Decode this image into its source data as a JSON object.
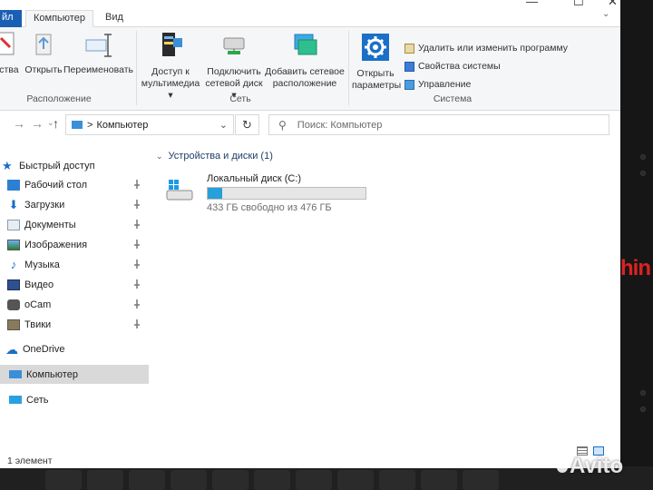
{
  "titlebar": {
    "controls": [
      "—",
      "☐",
      "✕"
    ]
  },
  "ribbon_tabs": {
    "file": "йл",
    "computer": "Компьютер",
    "view": "Вид"
  },
  "ribbon": {
    "location_group": {
      "label": "Расположение",
      "properties": "йства",
      "open": "Открыть",
      "rename": "Переименовать"
    },
    "network_group": {
      "label": "Сеть",
      "media_access_l1": "Доступ к",
      "media_access_l2": "мультимедиа ▾",
      "map_drive_l1": "Подключить",
      "map_drive_l2": "сетевой диск ▾",
      "add_location_l1": "Добавить сетевое",
      "add_location_l2": "расположение"
    },
    "system_group": {
      "label": "Система",
      "open_settings_l1": "Открыть",
      "open_settings_l2": "параметры",
      "uninstall": "Удалить или изменить программу",
      "system_properties": "Свойства системы",
      "manage": "Управление"
    }
  },
  "address": {
    "path": "Компьютер",
    "search_placeholder": "Поиск: Компьютер"
  },
  "nav": {
    "quick_access": "Быстрый доступ",
    "items": [
      {
        "label": "Рабочий стол",
        "icon": "desktop-icon"
      },
      {
        "label": "Загрузки",
        "icon": "downloads-icon"
      },
      {
        "label": "Документы",
        "icon": "documents-icon"
      },
      {
        "label": "Изображения",
        "icon": "pictures-icon"
      },
      {
        "label": "Музыка",
        "icon": "music-icon"
      },
      {
        "label": "Видео",
        "icon": "video-icon"
      },
      {
        "label": "oCam",
        "icon": "folder-icon"
      },
      {
        "label": "Твики",
        "icon": "folder-icon"
      }
    ],
    "onedrive": "OneDrive",
    "computer": "Компьютер",
    "network": "Сеть"
  },
  "content": {
    "group_header": "Устройства и диски (1)",
    "drive": {
      "name": "Локальный диск (C:)",
      "free_text": "433 ГБ свободно из 476 ГБ",
      "used_fraction": 0.09
    }
  },
  "status": {
    "count": "1 элемент"
  },
  "bezel": {
    "brand": "hin",
    "watermark": "Avito"
  },
  "colors": {
    "accent": "#1a6fc8",
    "drive_fill": "#26a0da",
    "selected": "#d9d9d9",
    "brand_red": "#d22222"
  }
}
